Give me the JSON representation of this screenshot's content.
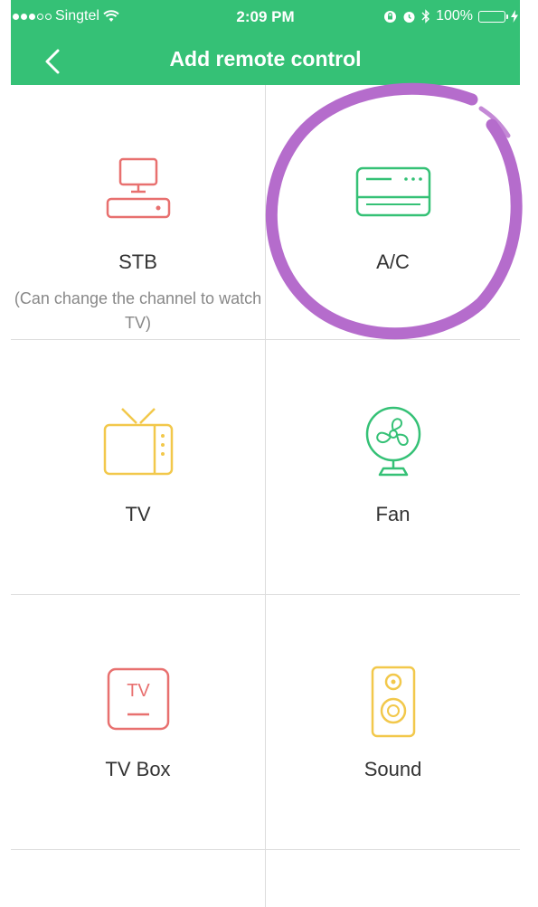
{
  "status_bar": {
    "carrier": "Singtel",
    "time": "2:09 PM",
    "battery": "100%"
  },
  "nav": {
    "title": "Add remote control"
  },
  "devices": [
    {
      "label": "STB",
      "sublabel": "(Can change the channel to watch TV)",
      "icon": "stb-icon",
      "color": "#e8706f"
    },
    {
      "label": "A/C",
      "icon": "air-conditioner-icon",
      "color": "#35c176"
    },
    {
      "label": "TV",
      "icon": "tv-icon",
      "color": "#f2c84b"
    },
    {
      "label": "Fan",
      "icon": "fan-icon",
      "color": "#35c176"
    },
    {
      "label": "TV Box",
      "icon": "tv-box-icon",
      "icon_text": "TV",
      "color": "#e8706f"
    },
    {
      "label": "Sound",
      "icon": "speaker-icon",
      "color": "#f2c84b"
    }
  ],
  "colors": {
    "header": "#35c176",
    "annotation": "#b56ccc"
  }
}
